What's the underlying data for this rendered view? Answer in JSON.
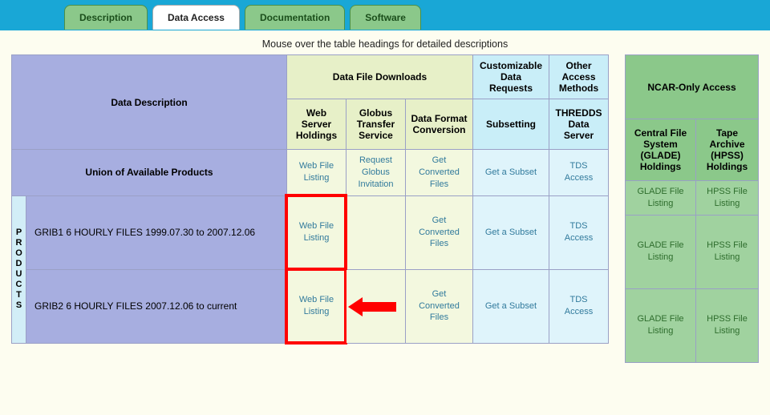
{
  "tabs": {
    "t0": "Description",
    "t1": "Data Access",
    "t2": "Documentation",
    "t3": "Software"
  },
  "hint": "Mouse over the table headings for detailed descriptions",
  "hdr": {
    "desc": "Data Description",
    "dl": "Data File Downloads",
    "cdr": "Customizable Data Requests",
    "oam": "Other Access Methods",
    "ncar": "NCAR-Only Access"
  },
  "sub": {
    "web": "Web Server Holdings",
    "globus": "Globus Transfer Service",
    "fmt": "Data Format Conversion",
    "subset": "Subsetting",
    "thredds": "THREDDS Data Server",
    "glade": "Central File System (GLADE) Holdings",
    "hpss": "Tape Archive (HPSS) Holdings"
  },
  "rows": {
    "union": "Union of Available Products",
    "p1": "GRIB1 6 HOURLY FILES 1999.07.30 to 2007.12.06",
    "p2": "GRIB2 6 HOURLY FILES 2007.12.06 to current",
    "products_label": "PRODUCTS"
  },
  "links": {
    "web": "Web File Listing",
    "globus": "Request Globus Invitation",
    "conv": "Get Converted Files",
    "subset": "Get a Subset",
    "tds": "TDS Access",
    "glade": "GLADE File Listing",
    "hpss": "HPSS File Listing"
  }
}
